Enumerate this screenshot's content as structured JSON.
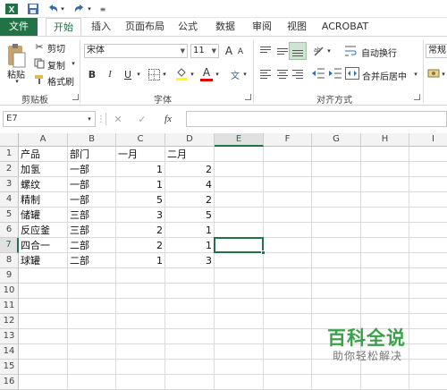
{
  "colors": {
    "accent": "#217346",
    "watermark": "#3aa04a"
  },
  "quick_access": {
    "save_icon": "save-icon",
    "undo_icon": "undo-icon",
    "redo_icon": "redo-icon",
    "customize_icon": "customize-icon"
  },
  "tabs": [
    {
      "label": "文件",
      "kind": "file"
    },
    {
      "label": "开始",
      "kind": "active"
    },
    {
      "label": "插入"
    },
    {
      "label": "页面布局"
    },
    {
      "label": "公式"
    },
    {
      "label": "数据"
    },
    {
      "label": "审阅"
    },
    {
      "label": "视图"
    },
    {
      "label": "ACROBAT"
    }
  ],
  "ribbon": {
    "clipboard": {
      "paste": "粘贴",
      "cut": "剪切",
      "copy": "复制",
      "format_painter": "格式刷",
      "group": "剪贴板"
    },
    "font": {
      "name": "宋体",
      "size": "11",
      "grow": "A",
      "shrink": "A",
      "bold": "B",
      "italic": "I",
      "underline": "U",
      "font_color": "A",
      "phonetic": "文",
      "group": "字体"
    },
    "alignment": {
      "wrap": "自动换行",
      "merge": "合并后居中",
      "group": "对齐方式"
    },
    "number": {
      "format": "常规"
    }
  },
  "formula_bar": {
    "name_box": "E7",
    "cancel": "✕",
    "enter": "✓",
    "fx": "fx",
    "value": ""
  },
  "sheet": {
    "columns": [
      "A",
      "B",
      "C",
      "D",
      "E",
      "F",
      "G",
      "H",
      "I"
    ],
    "rows": [
      "1",
      "2",
      "3",
      "4",
      "5",
      "6",
      "7",
      "8",
      "9",
      "10",
      "11",
      "12",
      "13",
      "14",
      "15",
      "16"
    ],
    "selected_cell": "E7",
    "data": [
      [
        "产品",
        "部门",
        "一月",
        "二月"
      ],
      [
        "加氢",
        "一部",
        "1",
        "2"
      ],
      [
        "螺纹",
        "一部",
        "1",
        "4"
      ],
      [
        "精制",
        "一部",
        "5",
        "2"
      ],
      [
        "储罐",
        "三部",
        "3",
        "5"
      ],
      [
        "反应釜",
        "三部",
        "2",
        "1"
      ],
      [
        "四合一",
        "二部",
        "2",
        "1"
      ],
      [
        "球罐",
        "二部",
        "1",
        "3"
      ]
    ]
  },
  "watermark": {
    "title": "百科全说",
    "subtitle": "助你轻松解决"
  }
}
